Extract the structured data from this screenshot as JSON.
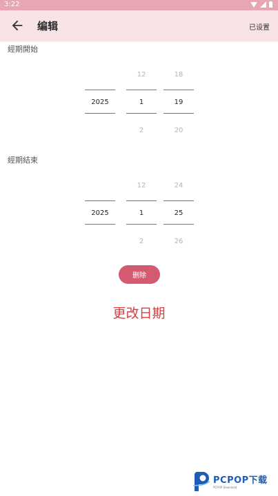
{
  "statusbar": {
    "time": "3:22"
  },
  "appbar": {
    "title": "编辑",
    "action": "已设置"
  },
  "start": {
    "label": "經期開始",
    "year": {
      "selected": "2025"
    },
    "month": {
      "prev": "12",
      "selected": "1",
      "next": "2"
    },
    "day": {
      "prev": "18",
      "selected": "19",
      "next": "20"
    }
  },
  "end": {
    "label": "經期結束",
    "year": {
      "selected": "2025"
    },
    "month": {
      "prev": "12",
      "selected": "1",
      "next": "2"
    },
    "day": {
      "prev": "24",
      "selected": "25",
      "next": "26"
    }
  },
  "delete_label": "删除",
  "change_date": "更改日期",
  "watermark": {
    "brand": "PCPOP下载",
    "sub": "PCPOP Download"
  },
  "colors": {
    "accent": "#d45a72",
    "appbar": "#f8e3e7",
    "statusbar": "#e8a6b2",
    "title_red": "#d93b3b"
  }
}
